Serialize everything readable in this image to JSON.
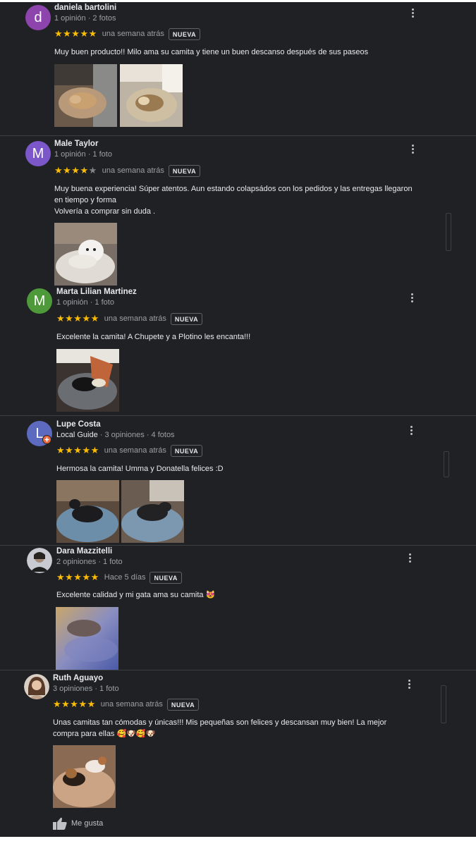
{
  "reviews": [
    {
      "author": "daniela bartolini",
      "avatar_letter": "d",
      "avatar_color": "#8e44ad",
      "meta": "1 opinión · 2 fotos",
      "stars": 5,
      "date": "una semana atrás",
      "badge": "NUEVA",
      "text": "Muy buen producto!! Milo ama su camita y tiene un buen descanso después de sus paseos",
      "photos": [
        "dog sleeping on tan round bed",
        "dogs on round bed near radiator"
      ]
    },
    {
      "author": "Male Taylor",
      "avatar_letter": "M",
      "avatar_color": "#7b57c9",
      "meta": "1 opinión · 1 foto",
      "stars": 4,
      "date": "una semana atrás",
      "badge": "NUEVA",
      "text_lines": [
        "Muy buena experiencia! Súper atentos. Aun estando colapsádos con los pedidos y las entregas llegaron",
        "en tiempo y forma",
        "Volvería a comprar sin duda ."
      ],
      "photos": [
        "white poodle on fluffy bed"
      ]
    },
    {
      "author": "Marta Lilian Martinez",
      "avatar_letter": "M",
      "avatar_color": "#4e9a3a",
      "meta": "1 opinión · 1 foto",
      "stars": 5,
      "date": "una semana atrás",
      "badge": "NUEVA",
      "text": "Excelente la camita! A Chupete y a Plotino les encanta!!!",
      "photos": [
        "cats on grey round bed"
      ]
    },
    {
      "author": "Lupe Costa",
      "avatar_letter": "L",
      "avatar_color": "#5c6bc0",
      "local_guide": "Local Guide",
      "meta": " · 3 opiniones · 4 fotos",
      "stars": 5,
      "date": "una semana atrás",
      "badge": "NUEVA",
      "text": "Hermosa la camita! Umma y Donatella felices :D",
      "photos": [
        "black dog on blue bed",
        "black dog on blue bed 2"
      ]
    },
    {
      "author": "Dara Mazzitelli",
      "meta": "2 opiniones · 1 foto",
      "stars": 5,
      "date": "Hace 5 días",
      "badge": "NUEVA",
      "text": "Excelente calidad y mi gata ama su camita 😻",
      "photos": [
        "cat on fluffy blue bed"
      ]
    },
    {
      "author": "Ruth Aguayo",
      "meta": "3 opiniones · 1 foto",
      "stars": 5,
      "date": "una semana atrás",
      "badge": "NUEVA",
      "text_lines": [
        "Unas camitas tan cómodas y únicas!!! Mis pequeñas son felices y descansan muy bien! La mejor",
        "compra para ellas 🥰🐶🥰🐶"
      ],
      "photos": [
        "beagles on tan bed"
      ],
      "like_label": "Me gusta"
    }
  ],
  "colors": {
    "star": "#fbbc04",
    "background": "#202124",
    "divider": "#3c4043"
  },
  "icons": [
    "more-vert-icon",
    "thumb-up-icon",
    "local-guide-icon",
    "star-icon"
  ]
}
